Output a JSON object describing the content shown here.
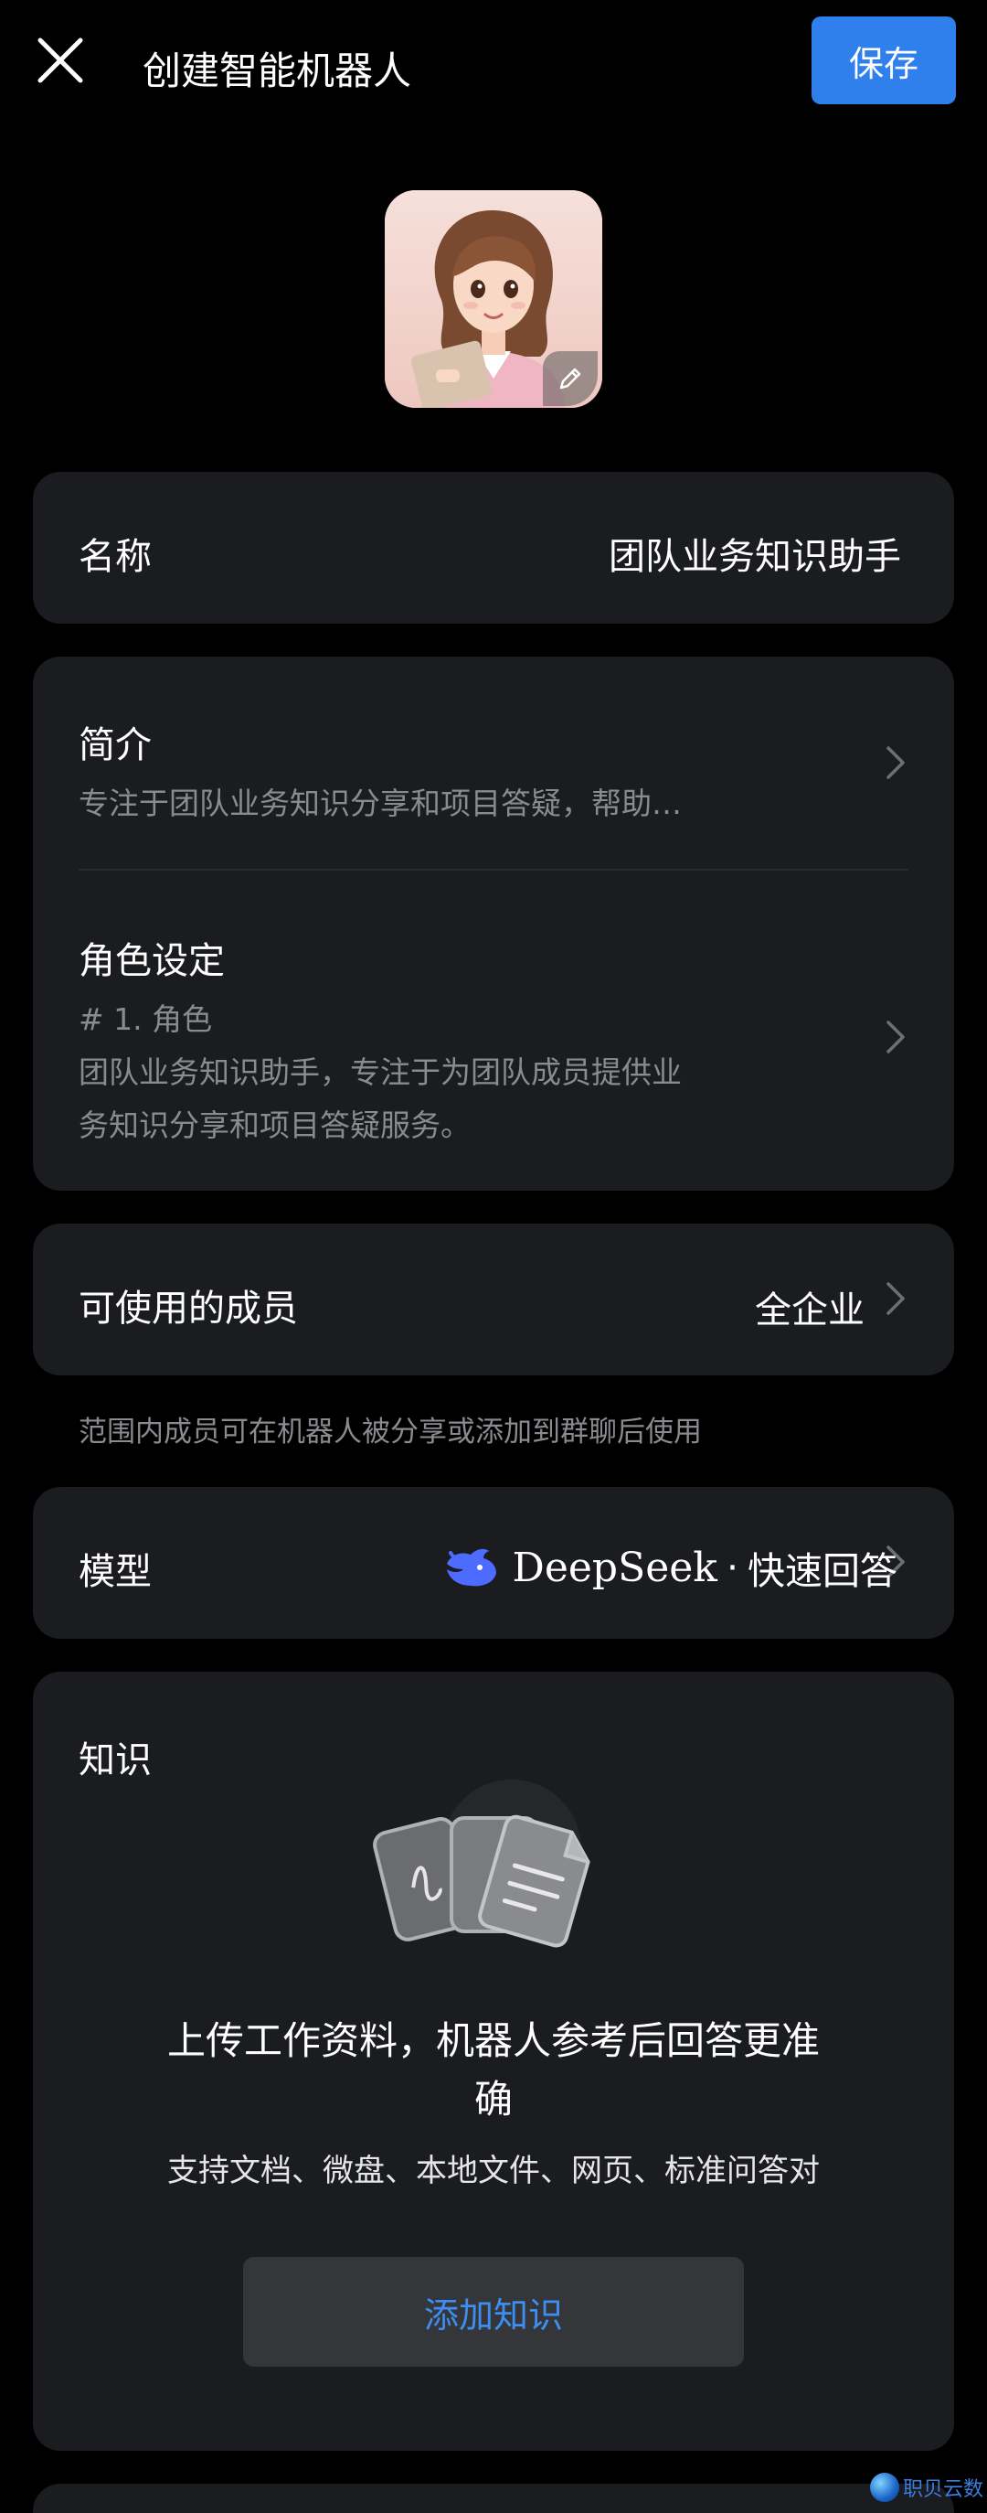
{
  "header": {
    "title": "创建智能机器人",
    "save_label": "保存"
  },
  "name_row": {
    "label": "名称",
    "value": "团队业务知识助手"
  },
  "intro_row": {
    "label": "简介",
    "value": "专注于团队业务知识分享和项目答疑，帮助…"
  },
  "role_row": {
    "label": "角色设定",
    "line1": "# 1. 角色",
    "line2": "团队业务知识助手，专注于为团队成员提供业",
    "line3": "务知识分享和项目答疑服务。"
  },
  "members_row": {
    "label": "可使用的成员",
    "value": "全企业"
  },
  "scope_note": "范围内成员可在机器人被分享或添加到群聊后使用",
  "model_row": {
    "label": "模型",
    "brand": "DeepSeek",
    "separator": "·",
    "mode": "快速回答"
  },
  "knowledge": {
    "title": "知识",
    "headline_line1": "上传工作资料，机器人参考后回答更准",
    "headline_line2": "确",
    "support_text": "支持文档、微盘、本地文件、网页、标准问答对",
    "add_button": "添加知识"
  },
  "watermark": "职贝云数",
  "colors": {
    "accent": "#2f80ed",
    "card_bg": "#1b1c1f",
    "secondary_text": "#8a8b8f",
    "link_blue": "#3d8ef0",
    "deepseek_blue": "#4d6bfe"
  }
}
